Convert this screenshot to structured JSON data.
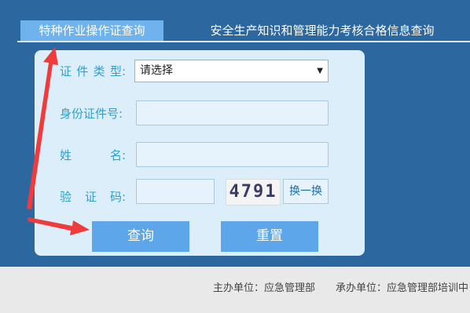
{
  "tabs": [
    {
      "label": "特种作业操作证查询",
      "active": true
    },
    {
      "label": "安全生产知识和管理能力考核合格信息查询",
      "active": false
    }
  ],
  "form": {
    "cert_type": {
      "label_chars": [
        "证",
        "件",
        "类",
        "型:"
      ],
      "selected": "请选择"
    },
    "id_number": {
      "label": "身份证件号:",
      "value": ""
    },
    "name": {
      "label_chars": [
        "姓",
        "名:"
      ],
      "value": ""
    },
    "captcha": {
      "label_chars": [
        "验",
        "证",
        "码:"
      ],
      "value": "",
      "image_text": "4791",
      "refresh_label": "换一换"
    }
  },
  "buttons": {
    "query": "查询",
    "reset": "重置"
  },
  "footer": {
    "host": "主办单位：应急管理部",
    "organizer": "承办单位：应急管理部培训中"
  },
  "colors": {
    "header_bg": "#2d67a0",
    "active_tab": "#6fb2ee",
    "panel_bg": "#ddeefb",
    "label": "#2f9fd3",
    "button": "#5da6ea",
    "annotation_arrow": "#ef3b3b"
  }
}
